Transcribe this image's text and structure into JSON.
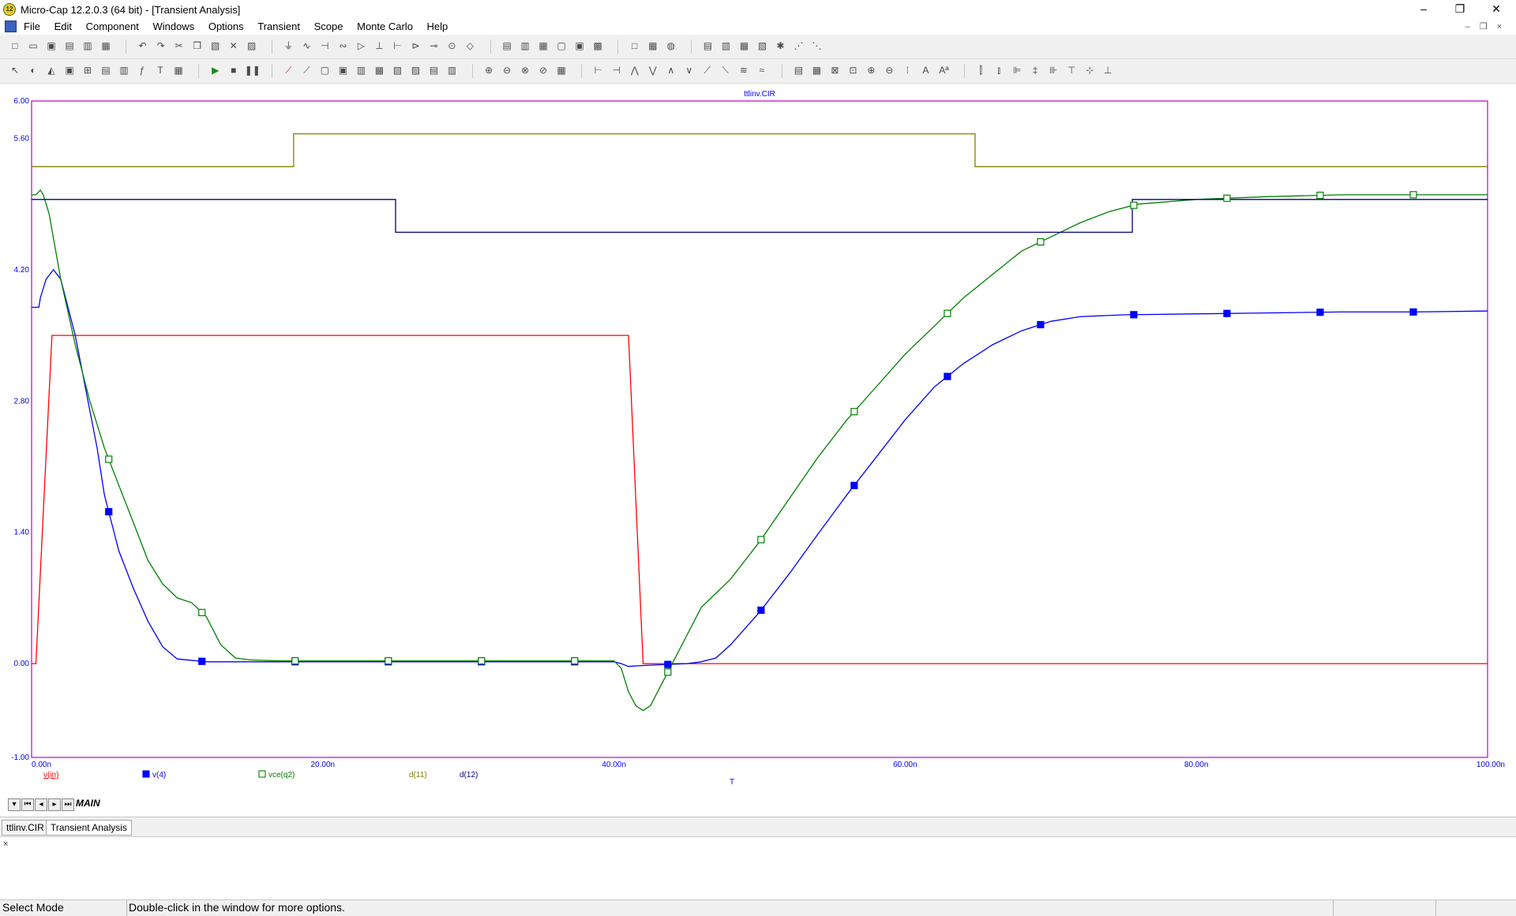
{
  "window": {
    "title": "Micro-Cap 12.2.0.3 (64 bit) - [Transient Analysis]",
    "icon_text": "12",
    "controls": {
      "minimize": "–",
      "maximize": "❐",
      "close": "✕"
    }
  },
  "menu": [
    "File",
    "Edit",
    "Component",
    "Windows",
    "Options",
    "Transient",
    "Scope",
    "Monte Carlo",
    "Help"
  ],
  "tabs": {
    "sheet": "MAIN",
    "documents": [
      "ttlinv.CIR",
      "Transient Analysis"
    ]
  },
  "status": {
    "mode": "Select Mode",
    "message": "Double-click in the window for more options."
  },
  "output_pane": {
    "close_label": "×"
  },
  "colors": {
    "v_in": "#ff0000",
    "v4": "#0000ff",
    "vce_q2": "#008000",
    "d11": "#808000",
    "d12": "#000080",
    "plot_border": "#c000c0",
    "axis_text": "#0000ff"
  },
  "chart_data": {
    "type": "line",
    "title": "ttlinv.CIR",
    "xlabel": "T",
    "x_tick_labels": [
      "0.00n",
      "20.00n",
      "40.00n",
      "60.00n",
      "80.00n",
      "100.00n"
    ],
    "y_tick_labels": [
      "6.00",
      "5.60",
      "4.20",
      "2.80",
      "1.40",
      "0.00",
      "-1.00"
    ],
    "y_tick_values": [
      6.0,
      5.6,
      4.2,
      2.8,
      1.4,
      0.0,
      -1.0
    ],
    "xlim": [
      0,
      100
    ],
    "ylim": [
      -1.0,
      6.0
    ],
    "grid": false,
    "legend_position": "bottom-left",
    "series": [
      {
        "name": "v(in)",
        "key": "v_in",
        "marker": "none",
        "x": [
          0,
          0.3,
          1.4,
          41.0,
          42.0,
          100
        ],
        "y": [
          0,
          0,
          3.5,
          3.5,
          0,
          0
        ]
      },
      {
        "name": "v(4)",
        "key": "v4",
        "marker": "filled-square",
        "x": [
          0,
          0.5,
          0.6,
          1.0,
          1.5,
          2.0,
          3.0,
          4.5,
          5.0,
          6.0,
          7.0,
          8.0,
          9.0,
          10.0,
          12.0,
          15.0,
          20.0,
          30.0,
          40.0,
          40.5,
          41.0,
          42.0,
          45.0,
          46.0,
          47.0,
          48.0,
          50.0,
          52.0,
          54.0,
          56.0,
          58.0,
          60.0,
          62.0,
          64.0,
          66.0,
          68.0,
          70.0,
          72.0,
          75.0,
          80.0,
          85.0,
          90.0,
          95.0,
          100.0
        ],
        "y": [
          3.8,
          3.8,
          3.9,
          4.1,
          4.2,
          4.1,
          3.5,
          2.3,
          1.8,
          1.2,
          0.8,
          0.45,
          0.18,
          0.05,
          0.02,
          0.02,
          0.02,
          0.02,
          0.02,
          0.0,
          -0.03,
          -0.02,
          0.0,
          0.02,
          0.06,
          0.2,
          0.55,
          0.95,
          1.38,
          1.8,
          2.2,
          2.6,
          2.95,
          3.2,
          3.4,
          3.55,
          3.65,
          3.7,
          3.72,
          3.73,
          3.74,
          3.75,
          3.75,
          3.76
        ]
      },
      {
        "name": "vce(q2)",
        "key": "vce_q2",
        "marker": "open-square",
        "x": [
          0,
          0.3,
          0.6,
          0.8,
          1.2,
          2.0,
          3.0,
          4.0,
          5.0,
          6.0,
          7.0,
          8.0,
          9.0,
          10.0,
          11.0,
          12.0,
          13.0,
          14.0,
          15.0,
          17.0,
          20.0,
          30.0,
          40.0,
          40.5,
          41.0,
          41.5,
          42.0,
          42.5,
          43.0,
          44.0,
          45.0,
          46.0,
          47.0,
          48.0,
          50.0,
          52.0,
          54.0,
          56.0,
          58.0,
          60.0,
          62.0,
          64.0,
          66.0,
          68.0,
          70.0,
          72.0,
          74.0,
          76.0,
          80.0,
          85.0,
          90.0,
          95.0,
          100.0
        ],
        "y": [
          5.0,
          5.0,
          5.05,
          5.0,
          4.8,
          4.1,
          3.4,
          2.8,
          2.3,
          1.9,
          1.5,
          1.1,
          0.85,
          0.7,
          0.65,
          0.5,
          0.2,
          0.06,
          0.04,
          0.03,
          0.03,
          0.03,
          0.03,
          -0.05,
          -0.3,
          -0.45,
          -0.5,
          -0.45,
          -0.3,
          0.0,
          0.3,
          0.6,
          0.75,
          0.9,
          1.3,
          1.75,
          2.2,
          2.6,
          2.95,
          3.3,
          3.6,
          3.9,
          4.15,
          4.4,
          4.55,
          4.7,
          4.82,
          4.9,
          4.95,
          4.98,
          5.0,
          5.0,
          5.0
        ]
      },
      {
        "name": "d(11)",
        "key": "d11",
        "marker": "none",
        "x": [
          0,
          18.0,
          18.0,
          64.8,
          64.8,
          100
        ],
        "y": [
          5.3,
          5.3,
          5.65,
          5.65,
          5.3,
          5.3
        ]
      },
      {
        "name": "d(12)",
        "key": "d12",
        "marker": "none",
        "x": [
          0,
          25.0,
          25.0,
          75.6,
          75.6,
          100
        ],
        "y": [
          4.95,
          4.95,
          4.6,
          4.6,
          4.95,
          4.95
        ]
      }
    ]
  }
}
